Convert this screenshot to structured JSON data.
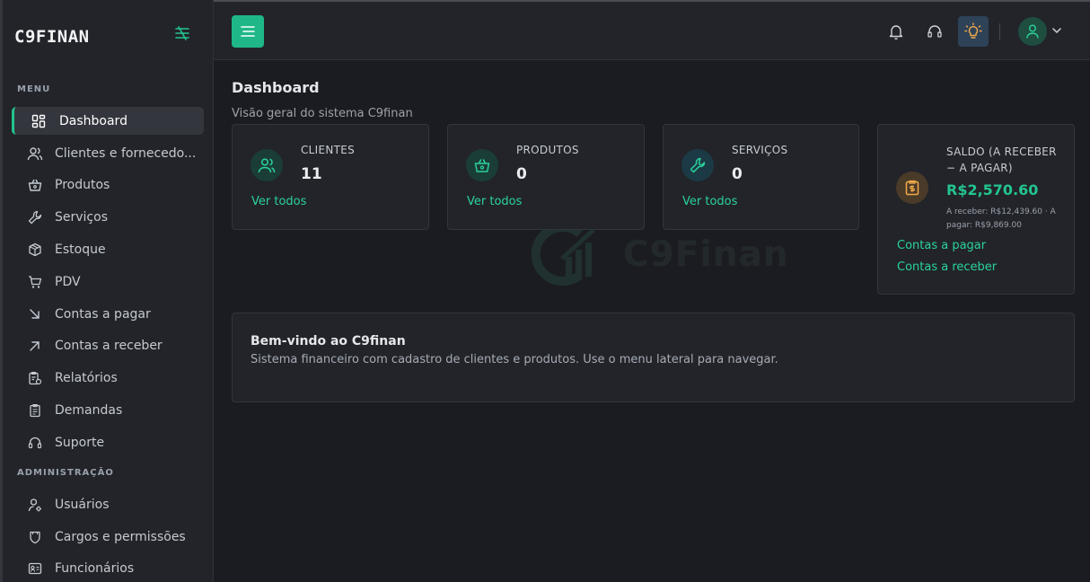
{
  "app": {
    "brand": "C9FINAN"
  },
  "sidebar": {
    "menu_label": "MENU",
    "admin_label": "ADMINISTRAÇÃO",
    "items": [
      {
        "label": "Dashboard",
        "icon": "grid-icon"
      },
      {
        "label": "Clientes e fornecedo...",
        "icon": "users-icon"
      },
      {
        "label": "Produtos",
        "icon": "basket-icon"
      },
      {
        "label": "Serviços",
        "icon": "wrench-icon"
      },
      {
        "label": "Estoque",
        "icon": "box-icon"
      },
      {
        "label": "PDV",
        "icon": "cart-icon"
      },
      {
        "label": "Contas a pagar",
        "icon": "arrow-down-right-icon"
      },
      {
        "label": "Contas a receber",
        "icon": "arrow-up-right-icon"
      },
      {
        "label": "Relatórios",
        "icon": "report-icon"
      },
      {
        "label": "Demandas",
        "icon": "clipboard-icon"
      },
      {
        "label": "Suporte",
        "icon": "headset-icon"
      }
    ],
    "admin_items": [
      {
        "label": "Usuários",
        "icon": "user-gear-icon"
      },
      {
        "label": "Cargos e permissões",
        "icon": "shield-icon"
      },
      {
        "label": "Funcionários",
        "icon": "id-card-icon"
      }
    ]
  },
  "page": {
    "title": "Dashboard",
    "subtitle": "Visão geral do sistema C9finan",
    "watermark": "C9Finan"
  },
  "cards": [
    {
      "label": "CLIENTES",
      "value": "11",
      "link": "Ver todos",
      "icon": "users-icon"
    },
    {
      "label": "PRODUTOS",
      "value": "0",
      "link": "Ver todos",
      "icon": "basket-icon"
    },
    {
      "label": "SERVIÇOS",
      "value": "0",
      "link": "Ver todos",
      "icon": "wrench-icon"
    }
  ],
  "saldo": {
    "label": "SALDO (A RECEBER − A PAGAR)",
    "value": "R$2,570.60",
    "detail": "A receber: R$12,439.60 · A pagar: R$9,869.00",
    "link_pagar": "Contas a pagar",
    "link_receber": "Contas a receber",
    "icon": "clipboard-money-icon"
  },
  "welcome": {
    "title": "Bem-vindo ao C9finan",
    "text": "Sistema financeiro com cadastro de clientes e produtos. Use o menu lateral para navegar."
  },
  "colors": {
    "accent": "#23c48e",
    "sidebar_bg": "#22242a",
    "page_bg": "#1b1c21",
    "warning": "#f0a94a"
  }
}
